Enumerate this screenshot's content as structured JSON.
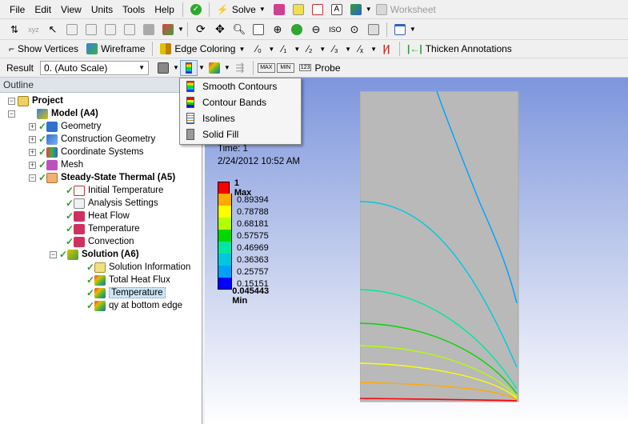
{
  "menu": [
    "File",
    "Edit",
    "View",
    "Units",
    "Tools",
    "Help"
  ],
  "toolbar1": {
    "solve_label": "Solve",
    "worksheet_label": "Worksheet"
  },
  "toolbar3": {
    "show_vertices": "Show Vertices",
    "wireframe": "Wireframe",
    "edge_coloring": "Edge Coloring",
    "thicken_annotations": "Thicken Annotations"
  },
  "toolbar4": {
    "result_label": "Result",
    "scale_value": "0. (Auto Scale)",
    "probe_label": "Probe"
  },
  "dropdown": [
    "Smooth Contours",
    "Contour Bands",
    "Isolines",
    "Solid Fill"
  ],
  "outline": {
    "title": "Outline",
    "nodes": [
      "Project",
      "Model (A4)",
      "Geometry",
      "Construction Geometry",
      "Coordinate Systems",
      "Mesh",
      "Steady-State Thermal (A5)",
      "Initial Temperature",
      "Analysis Settings",
      "Heat Flow",
      "Temperature",
      "Convection",
      "Solution (A6)",
      "Solution Information",
      "Total Heat Flux",
      "Temperature",
      "qy at bottom edge"
    ]
  },
  "viewport": {
    "time": "Time: 1",
    "date": "2/24/2012 10:52 AM",
    "legend": [
      "1 Max",
      "0.89394",
      "0.78788",
      "0.68181",
      "0.57575",
      "0.46969",
      "0.36363",
      "0.25757",
      "0.15151",
      "0.045443 Min"
    ],
    "legend_colors": [
      "#ff0000",
      "#ffaa00",
      "#ffff00",
      "#b4ff00",
      "#00d800",
      "#00e8a0",
      "#00c8e0",
      "#00a0ff",
      "#0000ff"
    ]
  }
}
